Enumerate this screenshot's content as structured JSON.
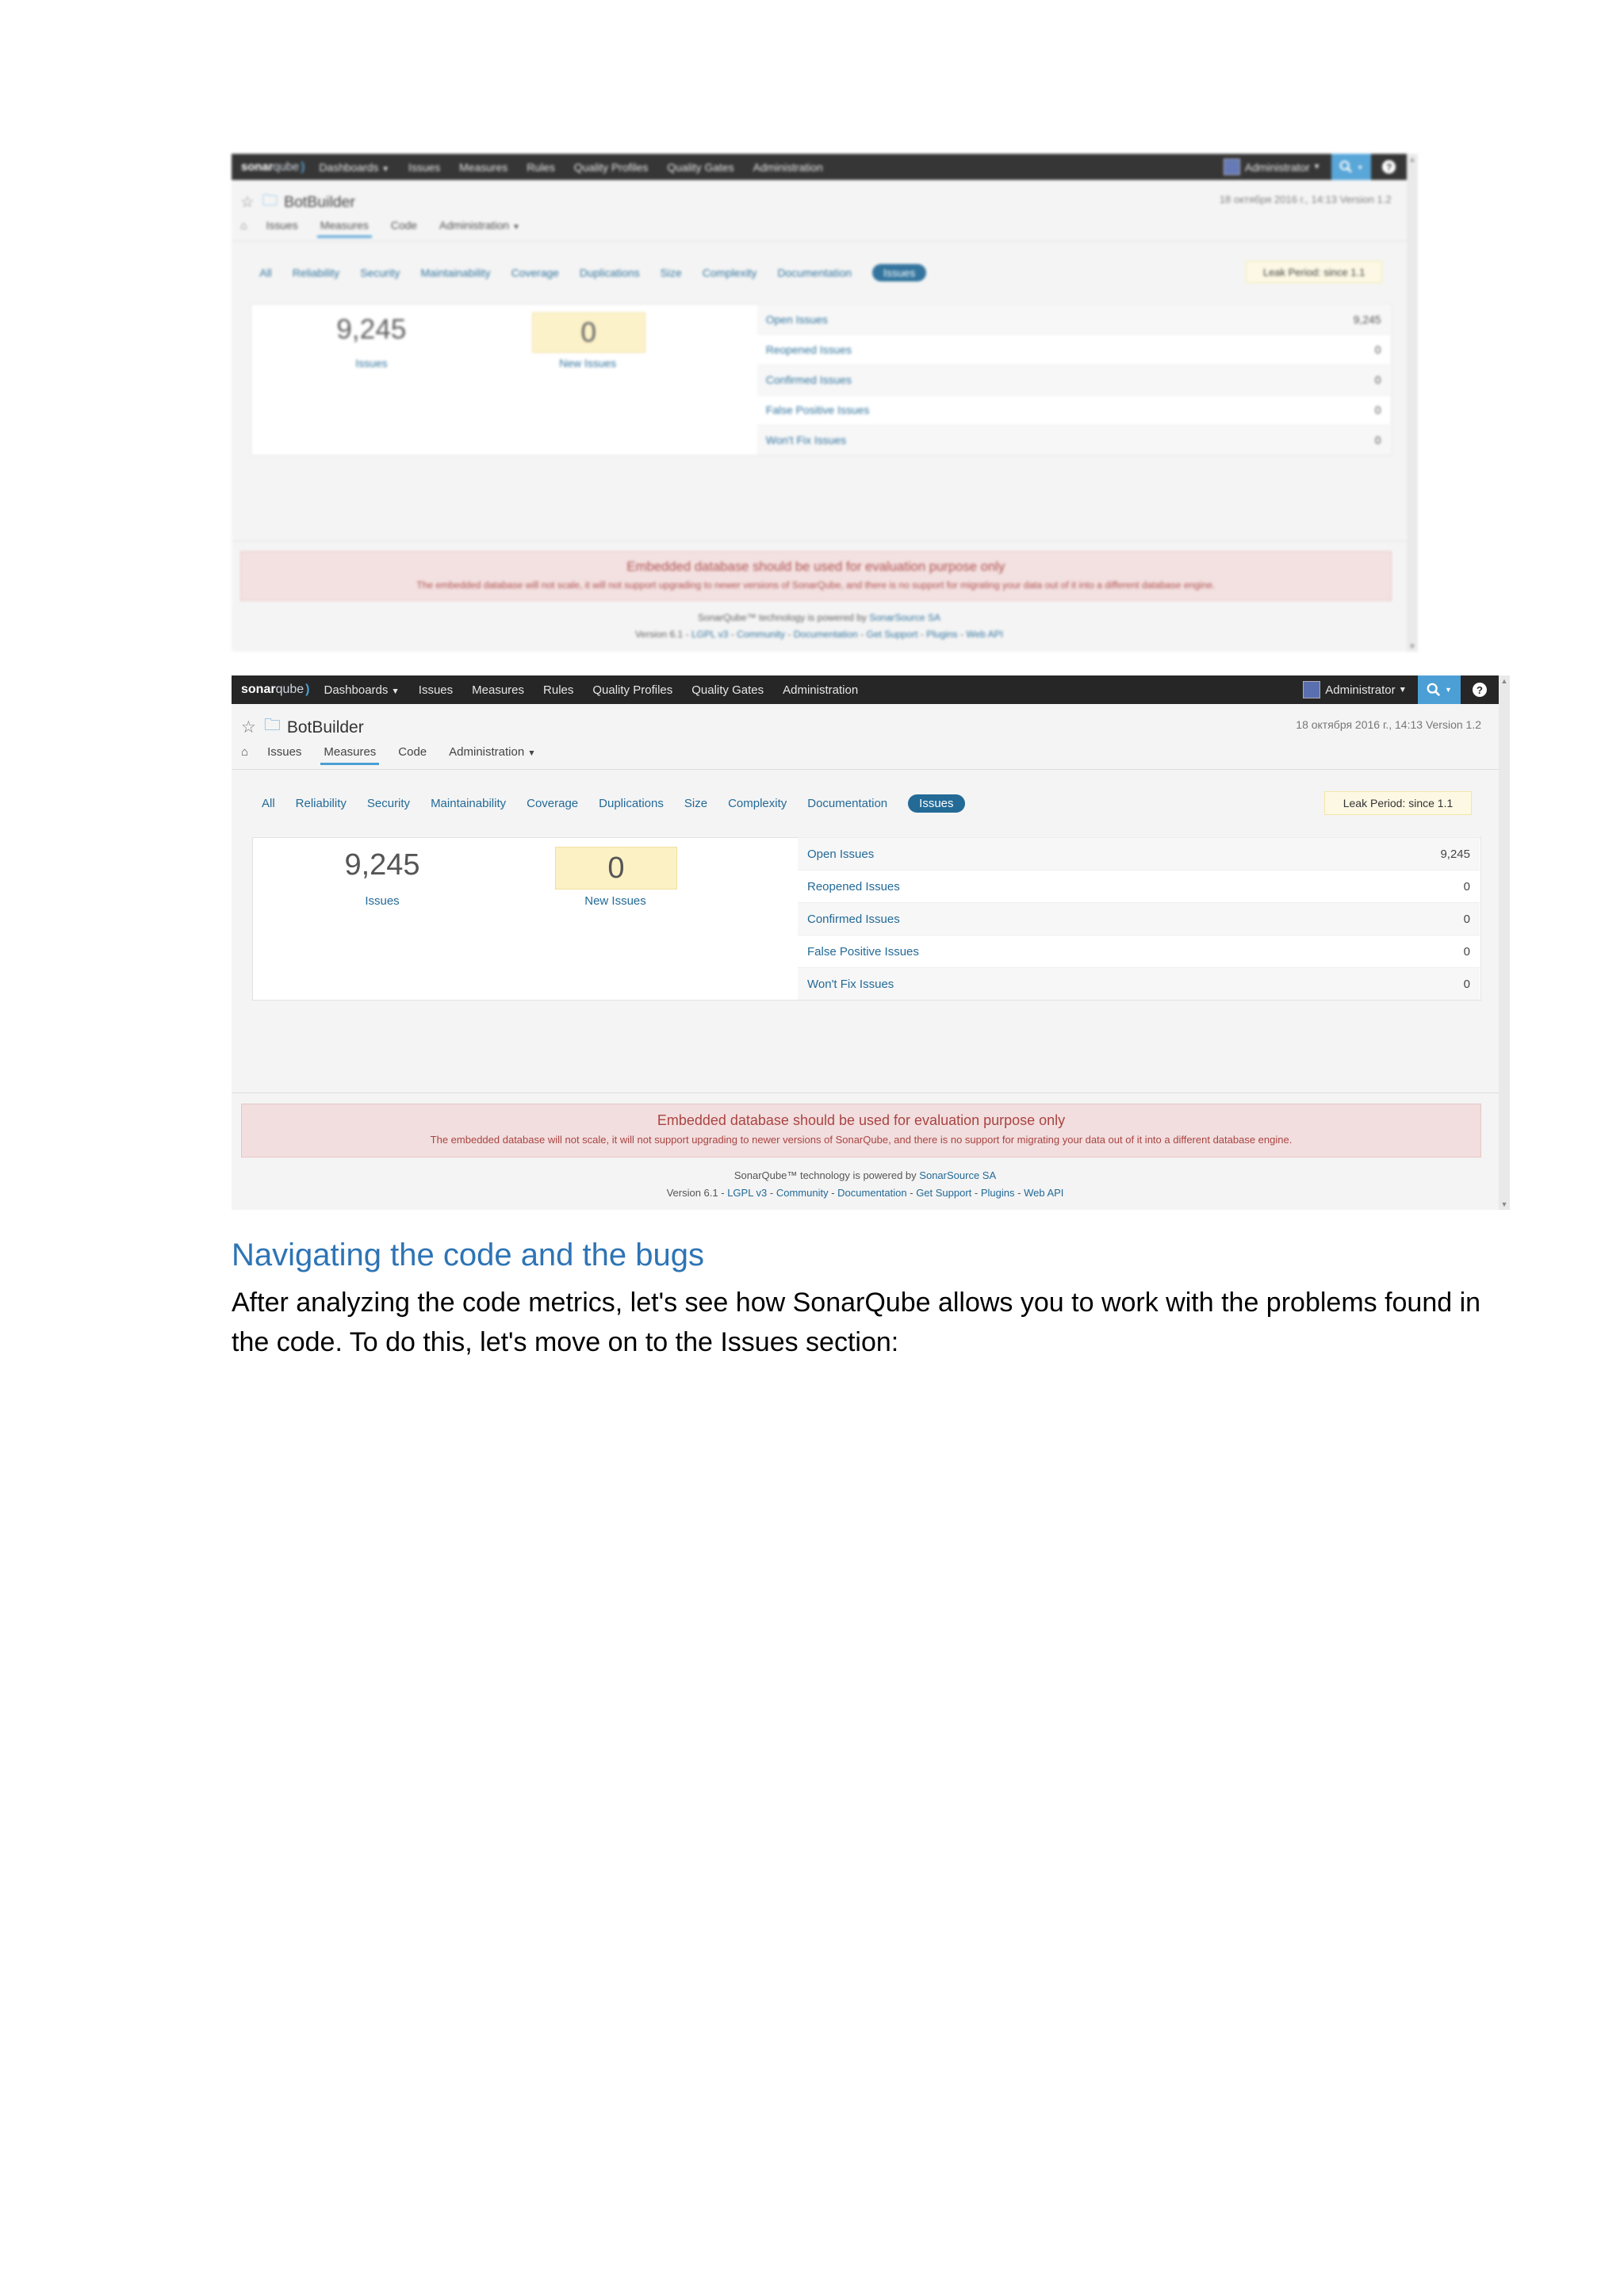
{
  "screenshots": [
    {
      "logo": {
        "brand": "sonar",
        "brand_q": "qube"
      },
      "nav": [
        "Dashboards",
        "Issues",
        "Measures",
        "Rules",
        "Quality Profiles",
        "Quality Gates",
        "Administration"
      ],
      "user_label": "Administrator",
      "project_name": "BotBuilder",
      "project_meta": "18 октября 2016 г., 14:13   Version 1.2",
      "subnav": [
        "Issues",
        "Measures",
        "Code",
        "Administration"
      ],
      "filters": [
        "All",
        "Reliability",
        "Security",
        "Maintainability",
        "Coverage",
        "Duplications",
        "Size",
        "Complexity",
        "Documentation",
        "Issues"
      ],
      "leak": "Leak Period: since 1.1",
      "issues_value": "9,245",
      "issues_label": "Issues",
      "new_value": "0",
      "new_label": "New Issues",
      "rows": [
        {
          "label": "Open Issues",
          "value": "9,245"
        },
        {
          "label": "Reopened Issues",
          "value": "0"
        },
        {
          "label": "Confirmed Issues",
          "value": "0"
        },
        {
          "label": "False Positive Issues",
          "value": "0"
        },
        {
          "label": "Won't Fix Issues",
          "value": "0"
        }
      ],
      "warning_title": "Embedded database should be used for evaluation purpose only",
      "warning_text": "The embedded database will not scale, it will not support upgrading to newer versions of SonarQube, and there is no support for migrating your data out of it into a different database engine.",
      "footer_powered_prefix": "SonarQube™ technology is powered by",
      "footer_powered_link": "SonarSource SA",
      "footer_version": "Version 6.1",
      "footer_links": [
        "LGPL v3",
        "Community",
        "Documentation",
        "Get Support",
        "Plugins",
        "Web API"
      ]
    },
    {
      "logo": {
        "brand": "sonar",
        "brand_q": "qube"
      },
      "nav": [
        "Dashboards",
        "Issues",
        "Measures",
        "Rules",
        "Quality Profiles",
        "Quality Gates",
        "Administration"
      ],
      "user_label": "Administrator",
      "project_name": "BotBuilder",
      "project_meta": "18 октября 2016 г., 14:13   Version 1.2",
      "subnav": [
        "Issues",
        "Measures",
        "Code",
        "Administration"
      ],
      "filters": [
        "All",
        "Reliability",
        "Security",
        "Maintainability",
        "Coverage",
        "Duplications",
        "Size",
        "Complexity",
        "Documentation",
        "Issues"
      ],
      "leak": "Leak Period: since 1.1",
      "issues_value": "9,245",
      "issues_label": "Issues",
      "new_value": "0",
      "new_label": "New Issues",
      "rows": [
        {
          "label": "Open Issues",
          "value": "9,245"
        },
        {
          "label": "Reopened Issues",
          "value": "0"
        },
        {
          "label": "Confirmed Issues",
          "value": "0"
        },
        {
          "label": "False Positive Issues",
          "value": "0"
        },
        {
          "label": "Won't Fix Issues",
          "value": "0"
        }
      ],
      "warning_title": "Embedded database should be used for evaluation purpose only",
      "warning_text": "The embedded database will not scale, it will not support upgrading to newer versions of SonarQube, and there is no support for migrating your data out of it into a different database engine.",
      "footer_powered_prefix": "SonarQube™ technology is powered by",
      "footer_powered_link": "SonarSource SA",
      "footer_version": "Version 6.1",
      "footer_links": [
        "LGPL v3",
        "Community",
        "Documentation",
        "Get Support",
        "Plugins",
        "Web API"
      ]
    }
  ],
  "doc": {
    "heading": "Navigating the code and the bugs",
    "paragraph": "After analyzing the code metrics, let's see how SonarQube allows you to work with the problems found in the code. To do this, let's move on to the Issues section:"
  },
  "colors": {
    "accent": "#4b9fd5",
    "link": "#236a97",
    "topbar": "#262626",
    "warning_bg": "#f2dede",
    "leak_bg": "#fcf8e3",
    "heading": "#2e74b5"
  }
}
